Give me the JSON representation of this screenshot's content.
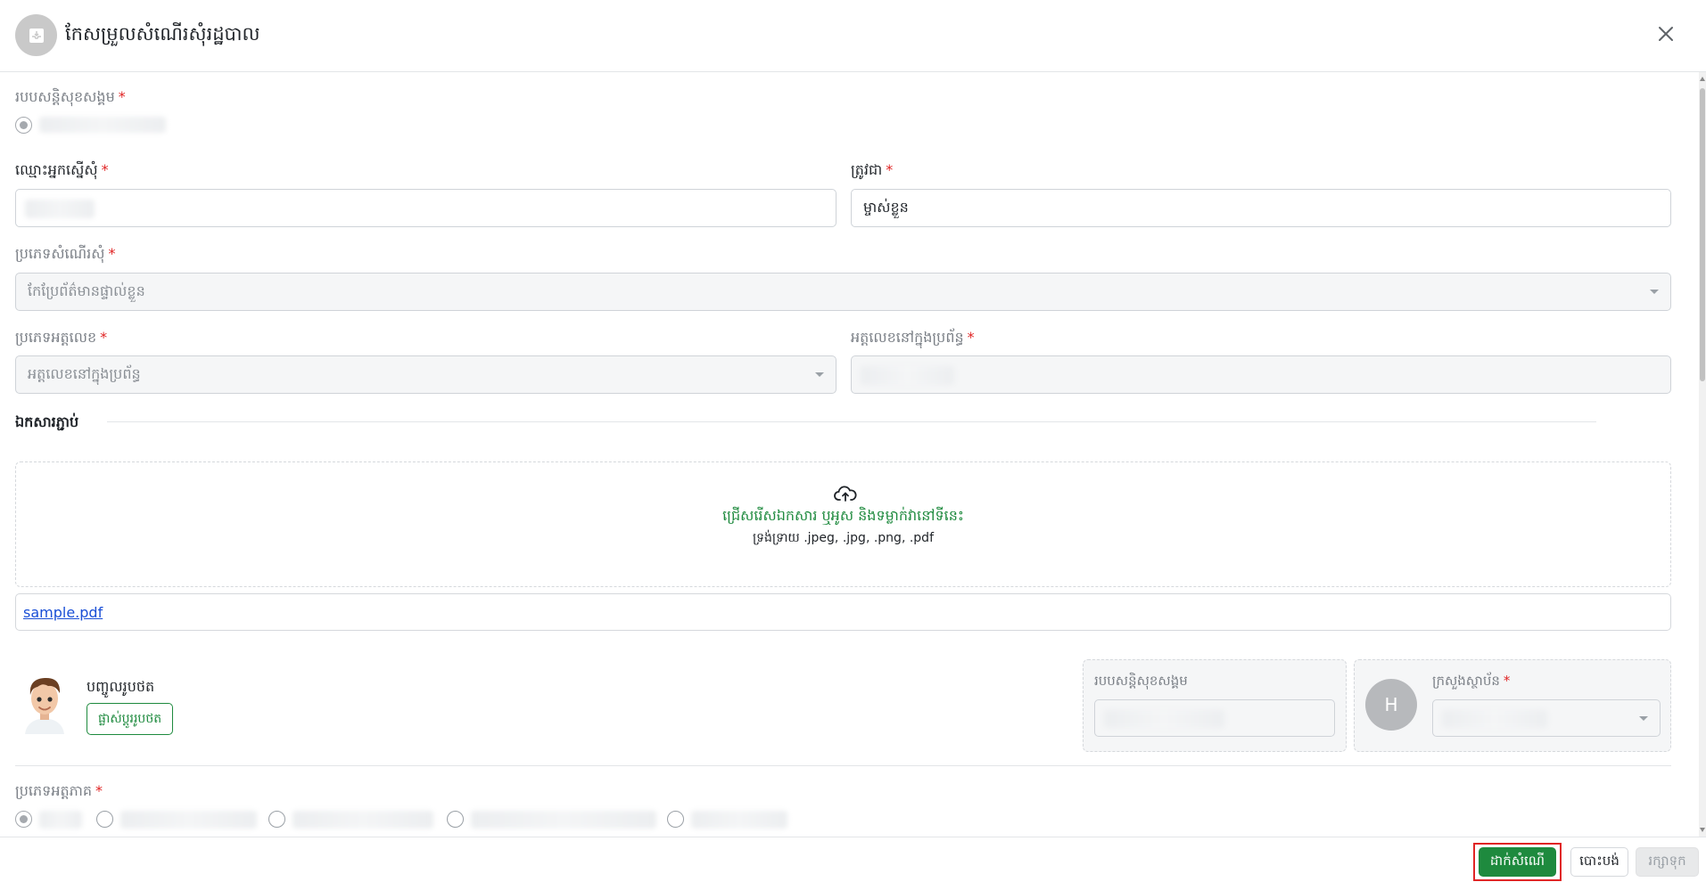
{
  "header": {
    "title": "កែសម្រួលសំណើរសុំរដ្ឋបាល"
  },
  "form": {
    "regime": {
      "label": "របបសន្តិសុខសង្គម"
    },
    "applicant": {
      "label": "ឈ្មោះអ្នកស្នើសុំ"
    },
    "relation": {
      "label": "ត្រូវជា",
      "value": "ម្ចាស់ខ្លួន"
    },
    "request_type": {
      "label": "ប្រភេទសំណើរសុំ",
      "placeholder": "កែប្រែព័ត៌មានផ្ទាល់ខ្លួន"
    },
    "id_type": {
      "label": "ប្រភេទអត្តលេខ",
      "value": "អត្តលេខនៅក្នុងប្រព័ន្ធ"
    },
    "system_id": {
      "label": "អត្តលេខនៅក្នុងប្រព័ន្ធ"
    }
  },
  "attachments": {
    "title": "ឯកសារភ្ជាប់",
    "drop_text": "ជ្រើសរើសឯកសារ ឬអូស និងទម្លាក់វានៅទីនេះ",
    "formats": "ទ្រង់ទ្រាយ .jpeg, .jpg, .png, .pdf",
    "file_name": "sample.pdf"
  },
  "photo": {
    "label": "បញ្ចូលរូបថត",
    "change_button": "ផ្លាស់ប្ដូររូបថត"
  },
  "card_regime": {
    "label": "របបសន្តិសុខសង្គម"
  },
  "card_ministry": {
    "avatar_letter": "H",
    "label": "ក្រសួងស្ថាប័ន"
  },
  "payer_type": {
    "label": "ប្រភេទអត្តភាគ"
  },
  "footer": {
    "submit": "ដាក់សំណើ",
    "cancel": "បោះបង់",
    "save": "រក្សាទុក"
  },
  "colors": {
    "primary": "#1e8a3e",
    "required": "#e02424",
    "link": "#1a4fd6"
  },
  "icons": {
    "header": "inbox-icon",
    "close": "close-icon",
    "upload": "cloud-upload-icon"
  }
}
